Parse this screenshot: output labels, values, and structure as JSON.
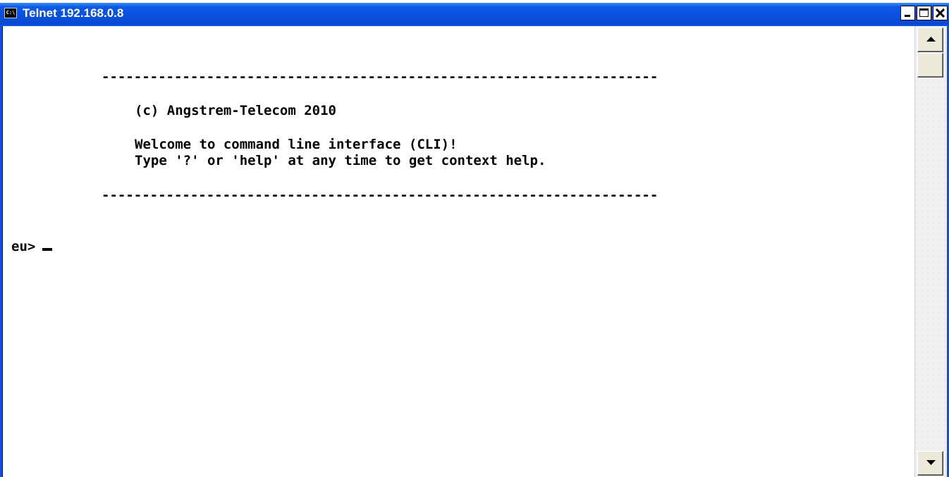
{
  "window": {
    "title": "Telnet 192.168.0.8",
    "app_icon_text": "C:\\"
  },
  "terminal": {
    "rule_top": "---------------------------------------------------------------------",
    "copyright": "(c) Angstrem-Telecom 2010",
    "welcome": "Welcome to command line interface (CLI)!",
    "help_hint": "Type '?' or 'help' at any time to get context help.",
    "rule_bottom": "---------------------------------------------------------------------",
    "prompt": "eu>"
  },
  "colors": {
    "titlebar": "#0a4fdc",
    "terminal_bg": "#ffffff",
    "terminal_text": "#000000"
  },
  "icons": {
    "app": "console-icon",
    "minimize": "minimize-icon",
    "maximize": "maximize-icon",
    "close": "close-icon",
    "scroll_up": "arrow-up-icon",
    "scroll_down": "arrow-down-icon"
  }
}
